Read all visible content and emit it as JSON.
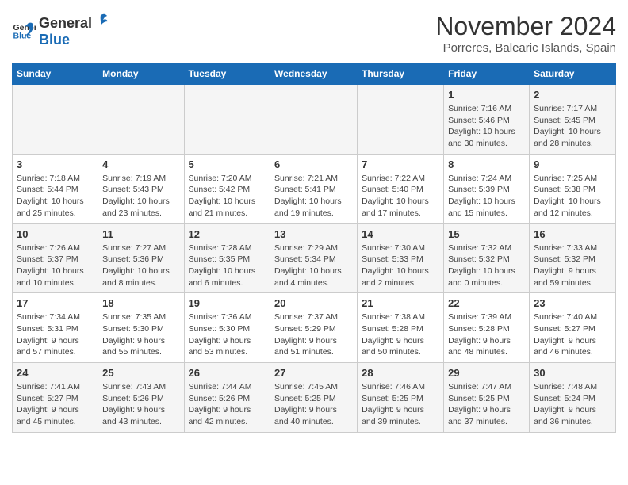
{
  "logo": {
    "general": "General",
    "blue": "Blue"
  },
  "title": "November 2024",
  "subtitle": "Porreres, Balearic Islands, Spain",
  "headers": [
    "Sunday",
    "Monday",
    "Tuesday",
    "Wednesday",
    "Thursday",
    "Friday",
    "Saturday"
  ],
  "weeks": [
    [
      {
        "day": "",
        "info": ""
      },
      {
        "day": "",
        "info": ""
      },
      {
        "day": "",
        "info": ""
      },
      {
        "day": "",
        "info": ""
      },
      {
        "day": "",
        "info": ""
      },
      {
        "day": "1",
        "info": "Sunrise: 7:16 AM\nSunset: 5:46 PM\nDaylight: 10 hours and 30 minutes."
      },
      {
        "day": "2",
        "info": "Sunrise: 7:17 AM\nSunset: 5:45 PM\nDaylight: 10 hours and 28 minutes."
      }
    ],
    [
      {
        "day": "3",
        "info": "Sunrise: 7:18 AM\nSunset: 5:44 PM\nDaylight: 10 hours and 25 minutes."
      },
      {
        "day": "4",
        "info": "Sunrise: 7:19 AM\nSunset: 5:43 PM\nDaylight: 10 hours and 23 minutes."
      },
      {
        "day": "5",
        "info": "Sunrise: 7:20 AM\nSunset: 5:42 PM\nDaylight: 10 hours and 21 minutes."
      },
      {
        "day": "6",
        "info": "Sunrise: 7:21 AM\nSunset: 5:41 PM\nDaylight: 10 hours and 19 minutes."
      },
      {
        "day": "7",
        "info": "Sunrise: 7:22 AM\nSunset: 5:40 PM\nDaylight: 10 hours and 17 minutes."
      },
      {
        "day": "8",
        "info": "Sunrise: 7:24 AM\nSunset: 5:39 PM\nDaylight: 10 hours and 15 minutes."
      },
      {
        "day": "9",
        "info": "Sunrise: 7:25 AM\nSunset: 5:38 PM\nDaylight: 10 hours and 12 minutes."
      }
    ],
    [
      {
        "day": "10",
        "info": "Sunrise: 7:26 AM\nSunset: 5:37 PM\nDaylight: 10 hours and 10 minutes."
      },
      {
        "day": "11",
        "info": "Sunrise: 7:27 AM\nSunset: 5:36 PM\nDaylight: 10 hours and 8 minutes."
      },
      {
        "day": "12",
        "info": "Sunrise: 7:28 AM\nSunset: 5:35 PM\nDaylight: 10 hours and 6 minutes."
      },
      {
        "day": "13",
        "info": "Sunrise: 7:29 AM\nSunset: 5:34 PM\nDaylight: 10 hours and 4 minutes."
      },
      {
        "day": "14",
        "info": "Sunrise: 7:30 AM\nSunset: 5:33 PM\nDaylight: 10 hours and 2 minutes."
      },
      {
        "day": "15",
        "info": "Sunrise: 7:32 AM\nSunset: 5:32 PM\nDaylight: 10 hours and 0 minutes."
      },
      {
        "day": "16",
        "info": "Sunrise: 7:33 AM\nSunset: 5:32 PM\nDaylight: 9 hours and 59 minutes."
      }
    ],
    [
      {
        "day": "17",
        "info": "Sunrise: 7:34 AM\nSunset: 5:31 PM\nDaylight: 9 hours and 57 minutes."
      },
      {
        "day": "18",
        "info": "Sunrise: 7:35 AM\nSunset: 5:30 PM\nDaylight: 9 hours and 55 minutes."
      },
      {
        "day": "19",
        "info": "Sunrise: 7:36 AM\nSunset: 5:30 PM\nDaylight: 9 hours and 53 minutes."
      },
      {
        "day": "20",
        "info": "Sunrise: 7:37 AM\nSunset: 5:29 PM\nDaylight: 9 hours and 51 minutes."
      },
      {
        "day": "21",
        "info": "Sunrise: 7:38 AM\nSunset: 5:28 PM\nDaylight: 9 hours and 50 minutes."
      },
      {
        "day": "22",
        "info": "Sunrise: 7:39 AM\nSunset: 5:28 PM\nDaylight: 9 hours and 48 minutes."
      },
      {
        "day": "23",
        "info": "Sunrise: 7:40 AM\nSunset: 5:27 PM\nDaylight: 9 hours and 46 minutes."
      }
    ],
    [
      {
        "day": "24",
        "info": "Sunrise: 7:41 AM\nSunset: 5:27 PM\nDaylight: 9 hours and 45 minutes."
      },
      {
        "day": "25",
        "info": "Sunrise: 7:43 AM\nSunset: 5:26 PM\nDaylight: 9 hours and 43 minutes."
      },
      {
        "day": "26",
        "info": "Sunrise: 7:44 AM\nSunset: 5:26 PM\nDaylight: 9 hours and 42 minutes."
      },
      {
        "day": "27",
        "info": "Sunrise: 7:45 AM\nSunset: 5:25 PM\nDaylight: 9 hours and 40 minutes."
      },
      {
        "day": "28",
        "info": "Sunrise: 7:46 AM\nSunset: 5:25 PM\nDaylight: 9 hours and 39 minutes."
      },
      {
        "day": "29",
        "info": "Sunrise: 7:47 AM\nSunset: 5:25 PM\nDaylight: 9 hours and 37 minutes."
      },
      {
        "day": "30",
        "info": "Sunrise: 7:48 AM\nSunset: 5:24 PM\nDaylight: 9 hours and 36 minutes."
      }
    ]
  ]
}
